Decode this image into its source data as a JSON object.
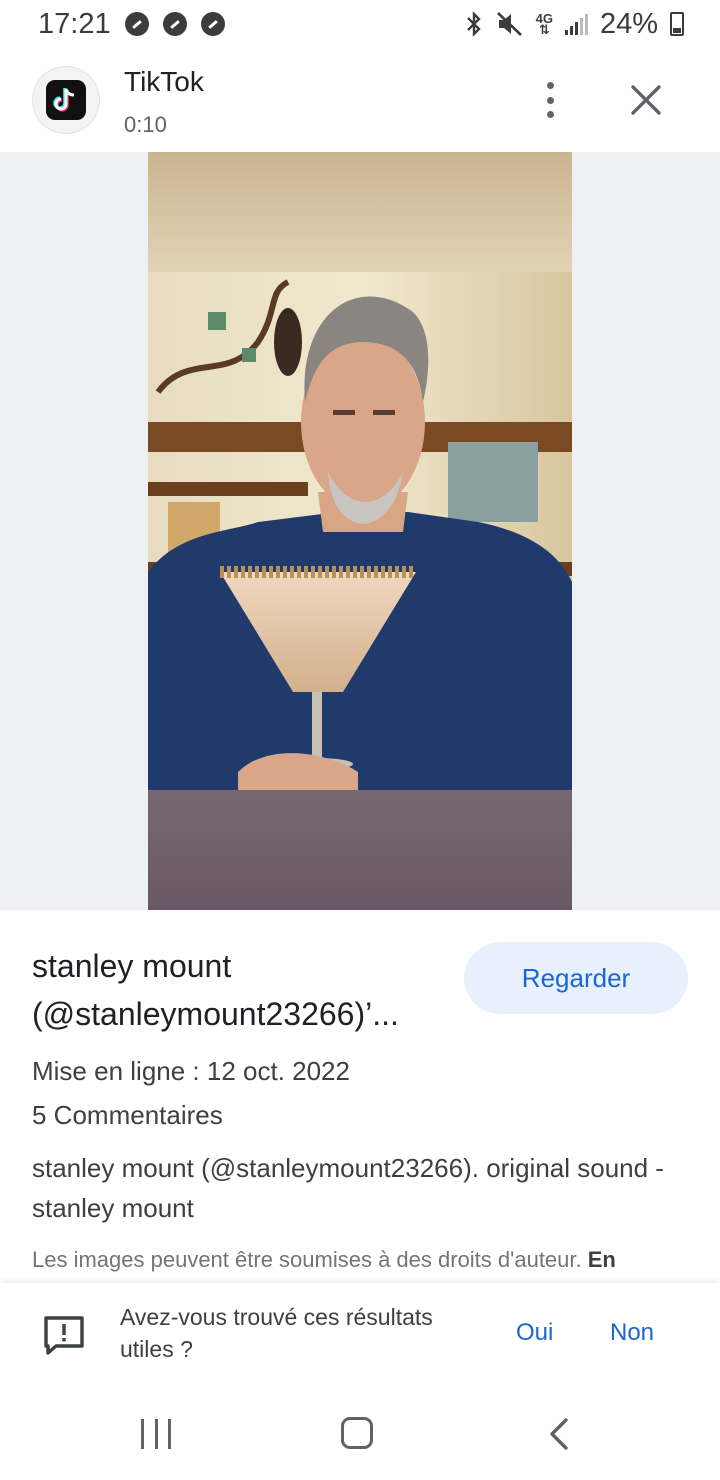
{
  "status_bar": {
    "time": "17:21",
    "network": "4G",
    "battery": "24%"
  },
  "header": {
    "app_name": "TikTok",
    "subtitle": "0:10"
  },
  "result": {
    "title": "stanley mount (@stanleymount23266)’...",
    "watch_label": "Regarder",
    "upload_date": "Mise en ligne : 12 oct. 2022",
    "comments": "5 Commentaires",
    "description": "stanley mount (@stanleymount23266). original sound - stanley mount",
    "copyright_notice": "Les images peuvent être soumises à des droits d'auteur.",
    "copyright_link": "En savoir plus"
  },
  "feedback": {
    "question": "Avez-vous trouvé ces résultats utiles ?",
    "yes_label": "Oui",
    "no_label": "Non"
  },
  "colors": {
    "accent": "#1967d2",
    "button_bg": "#e8f0fe",
    "media_bg": "#eef0f3"
  },
  "icons": [
    "tiktok-logo",
    "more-vert-icon",
    "close-icon",
    "feedback-icon",
    "recents-icon",
    "home-icon",
    "back-icon"
  ]
}
